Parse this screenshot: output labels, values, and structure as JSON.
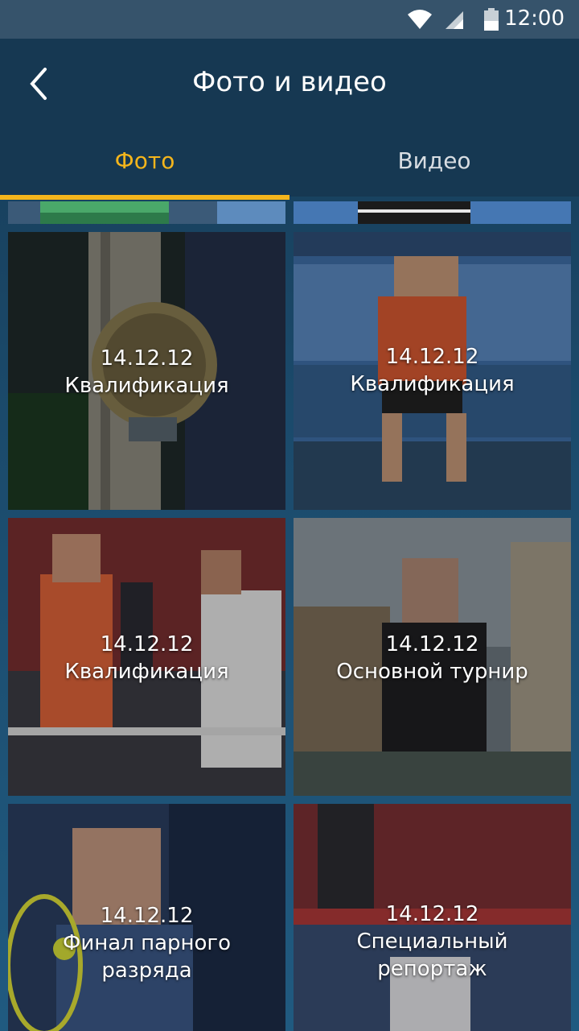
{
  "status": {
    "time": "12:00"
  },
  "header": {
    "title": "Фото и видео"
  },
  "tabs": [
    {
      "label": "Фото",
      "active": true
    },
    {
      "label": "Видео",
      "active": false
    }
  ],
  "gallery": [
    {
      "date": "14.12.12",
      "title": "Квалификация"
    },
    {
      "date": "14.12.12",
      "title": "Квалификация"
    },
    {
      "date": "14.12.12",
      "title": "Квалификация"
    },
    {
      "date": "14.12.12",
      "title": "Основной турнир"
    },
    {
      "date": "14.12.12",
      "title_line1": "Финал парного",
      "title_line2": "разряда"
    },
    {
      "date": "14.12.12",
      "title_line1": "Специальный",
      "title_line2": "репортаж"
    }
  ],
  "colors": {
    "accent": "#f4b51c",
    "appbar": "#163852",
    "statusbar": "#36536b"
  }
}
